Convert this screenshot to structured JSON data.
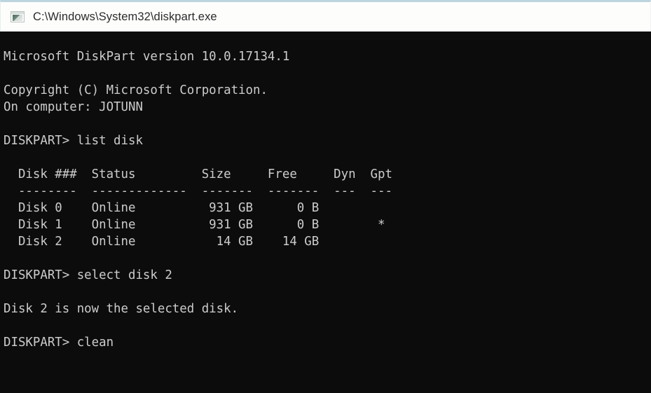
{
  "window": {
    "title": "C:\\Windows\\System32\\diskpart.exe",
    "icon": "console-window-icon",
    "titlebar_bg": "#fdfdfc",
    "titlebar_text_color": "#2b2b2b",
    "console_bg": "#0c0c0c",
    "console_text_color": "#cccccc",
    "left_edge_accent": "#16314b"
  },
  "console": {
    "prompt": "DISKPART>",
    "banner": {
      "product_line": "Microsoft DiskPart version 10.0.17134.1",
      "product": "Microsoft DiskPart",
      "version": "10.0.17134.1",
      "copyright": "Copyright (C) Microsoft Corporation.",
      "computer_label": "On computer:",
      "computer_name": "JOTUNN"
    },
    "commands": [
      {
        "prompt": "DISKPART>",
        "text": "list disk"
      },
      {
        "prompt": "DISKPART>",
        "text": "select disk 2"
      },
      {
        "prompt": "DISKPART>",
        "text": "clean"
      }
    ],
    "messages": [
      "Disk 2 is now the selected disk."
    ],
    "disk_table": {
      "headers": [
        "Disk ###",
        "Status",
        "Size",
        "Free",
        "Dyn",
        "Gpt"
      ],
      "separators": [
        "--------",
        "-------------",
        "-------",
        "-------",
        "---",
        "---"
      ],
      "rows": [
        {
          "disk": "Disk 0",
          "status": "Online",
          "size": "931 GB",
          "free": "0 B",
          "dyn": "",
          "gpt": ""
        },
        {
          "disk": "Disk 1",
          "status": "Online",
          "size": "931 GB",
          "free": "0 B",
          "dyn": "",
          "gpt": "*"
        },
        {
          "disk": "Disk 2",
          "status": "Online",
          "size": "14 GB",
          "free": "14 GB",
          "dyn": "",
          "gpt": ""
        }
      ]
    },
    "screen_text": "\nMicrosoft DiskPart version 10.0.17134.1\n\nCopyright (C) Microsoft Corporation.\nOn computer: JOTUNN\n\nDISKPART> list disk\n\n  Disk ###  Status         Size     Free     Dyn  Gpt\n  --------  -------------  -------  -------  ---  ---\n  Disk 0    Online          931 GB      0 B\n  Disk 1    Online          931 GB      0 B        *\n  Disk 2    Online           14 GB    14 GB\n\nDISKPART> select disk 2\n\nDisk 2 is now the selected disk.\n\nDISKPART> clean\n"
  }
}
